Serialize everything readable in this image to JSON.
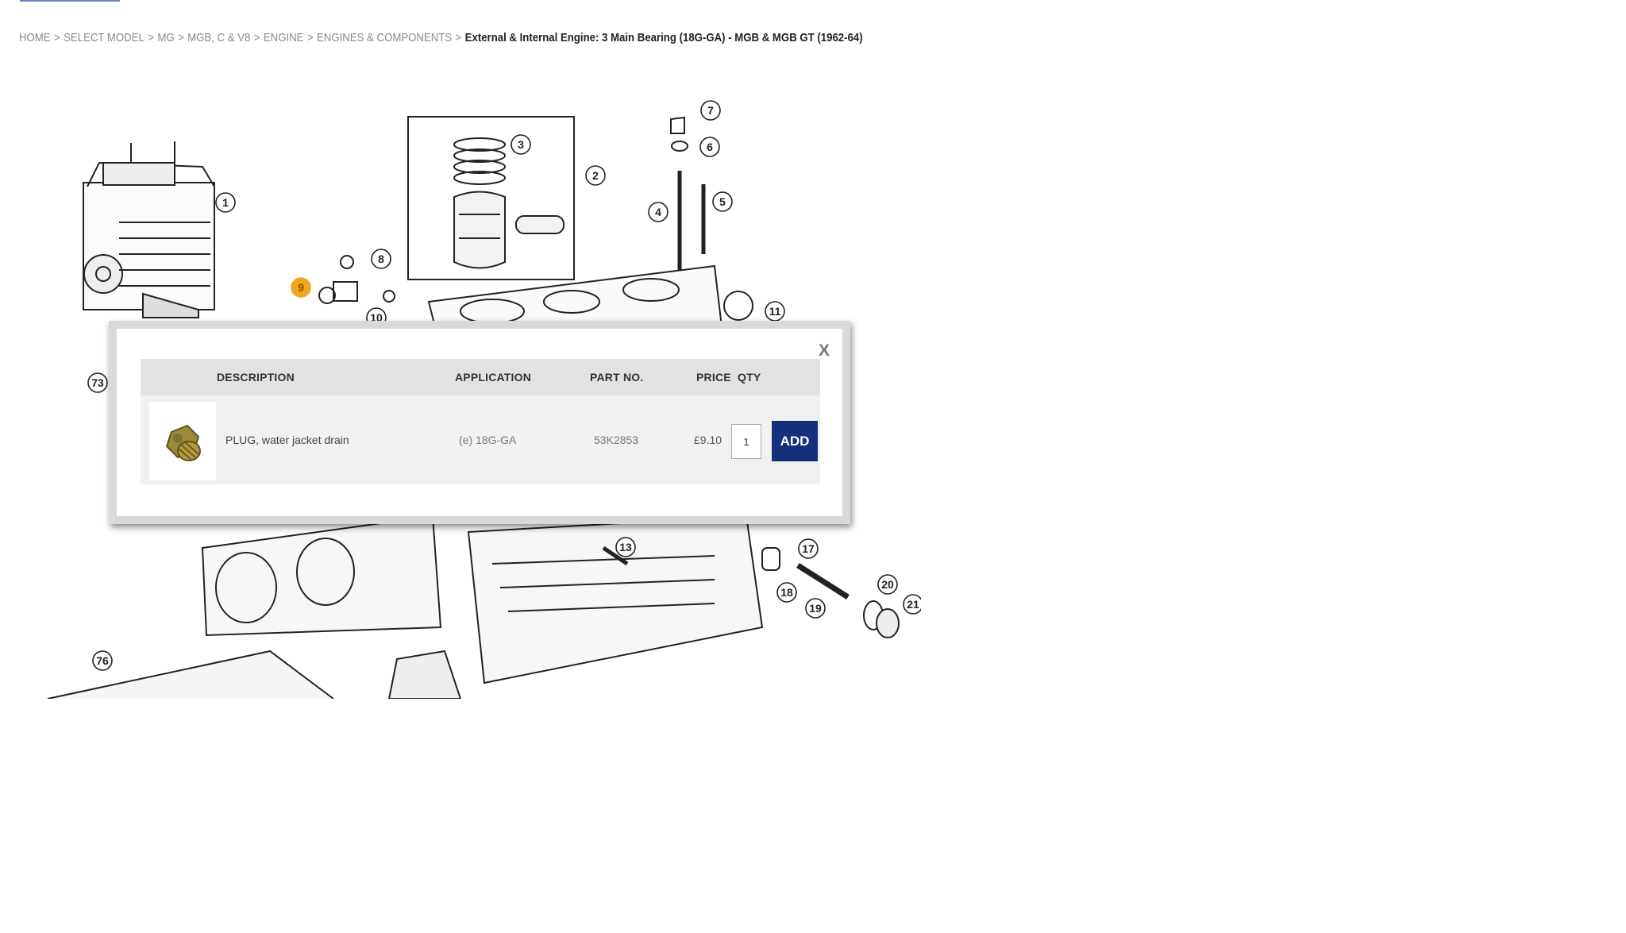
{
  "breadcrumb": {
    "items": [
      "HOME",
      "SELECT MODEL",
      "MG",
      "MGB, C & V8",
      "ENGINE",
      "ENGINES & COMPONENTS"
    ],
    "separator": ">",
    "current": "External & Internal Engine: 3 Main Bearing (18G-GA) - MGB & MGB GT (1962-64)"
  },
  "diagram": {
    "callouts": [
      "1",
      "2",
      "3",
      "4",
      "5",
      "6",
      "7",
      "8",
      "9",
      "10",
      "11",
      "13",
      "17",
      "18",
      "19",
      "20",
      "21",
      "73",
      "76"
    ],
    "highlighted_callout": "9"
  },
  "popup": {
    "close_label": "X",
    "headers": {
      "description": "DESCRIPTION",
      "application": "APPLICATION",
      "part_no": "PART NO.",
      "price": "PRICE",
      "qty": "QTY"
    },
    "row": {
      "description": "PLUG, water jacket drain",
      "application": "(e) 18G-GA",
      "part_no": "53K2853",
      "price": "£9.10",
      "qty": "1",
      "add_label": "ADD"
    }
  },
  "colors": {
    "add_button": "#15307a",
    "highlight_callout": "#f3a51f",
    "breadcrumb_link": "#8a8a8a",
    "top_underline": "#5f86c4"
  }
}
